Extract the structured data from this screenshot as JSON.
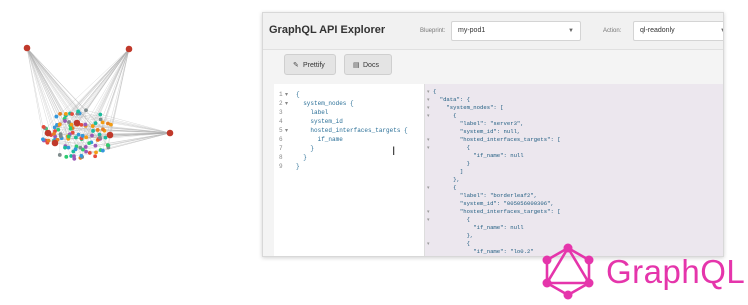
{
  "app": {
    "title": "GraphQL API Explorer",
    "blueprint_label": "Blueprint:",
    "blueprint_value": "my-pod1",
    "action_label": "Action:",
    "action_value": "ql-readonly"
  },
  "toolbar": {
    "prettify_label": "Prettify",
    "docs_label": "Docs"
  },
  "editor": {
    "lines": [
      {
        "num": "1",
        "fold": "▾",
        "text": "{"
      },
      {
        "num": "2",
        "fold": "▾",
        "text": "  system_nodes {"
      },
      {
        "num": "3",
        "fold": "",
        "text": "    label"
      },
      {
        "num": "4",
        "fold": "",
        "text": "    system_id"
      },
      {
        "num": "5",
        "fold": "▾",
        "text": "    hosted_interfaces_targets {"
      },
      {
        "num": "6",
        "fold": "",
        "text": "      if_name"
      },
      {
        "num": "7",
        "fold": "",
        "text": "    }"
      },
      {
        "num": "8",
        "fold": "",
        "text": "  }"
      },
      {
        "num": "9",
        "fold": "",
        "text": "}"
      }
    ]
  },
  "result": {
    "lines": [
      {
        "b": "▾",
        "t": "{"
      },
      {
        "b": "▾",
        "t": "  \"data\": {"
      },
      {
        "b": "▾",
        "t": "    \"system_nodes\": ["
      },
      {
        "b": "▾",
        "t": "      {"
      },
      {
        "b": "",
        "t": "        \"label\": \"server3\","
      },
      {
        "b": "",
        "t": "        \"system_id\": null,"
      },
      {
        "b": "▾",
        "t": "        \"hosted_interfaces_targets\": ["
      },
      {
        "b": "▾",
        "t": "          {"
      },
      {
        "b": "",
        "t": "            \"if_name\": null"
      },
      {
        "b": "",
        "t": "          }"
      },
      {
        "b": "",
        "t": "        ]"
      },
      {
        "b": "",
        "t": "      },"
      },
      {
        "b": "▾",
        "t": "      {"
      },
      {
        "b": "",
        "t": "        \"label\": \"borderleaf2\","
      },
      {
        "b": "",
        "t": "        \"system_id\": \"005056000306\","
      },
      {
        "b": "▾",
        "t": "        \"hosted_interfaces_targets\": ["
      },
      {
        "b": "▾",
        "t": "          {"
      },
      {
        "b": "",
        "t": "            \"if_name\": null"
      },
      {
        "b": "",
        "t": "          },"
      },
      {
        "b": "▾",
        "t": "          {"
      },
      {
        "b": "",
        "t": "            \"if_name\": \"lo0.2\""
      }
    ]
  },
  "logo": {
    "text": "GraphQL",
    "color": "#e535ab"
  },
  "graph": {
    "hub_color": "#c0392b",
    "node_colors": [
      "#e74c3c",
      "#3498db",
      "#2ecc71",
      "#f39c12",
      "#9b59b6",
      "#1abc9c",
      "#e67e22",
      "#7f8c8d"
    ]
  }
}
